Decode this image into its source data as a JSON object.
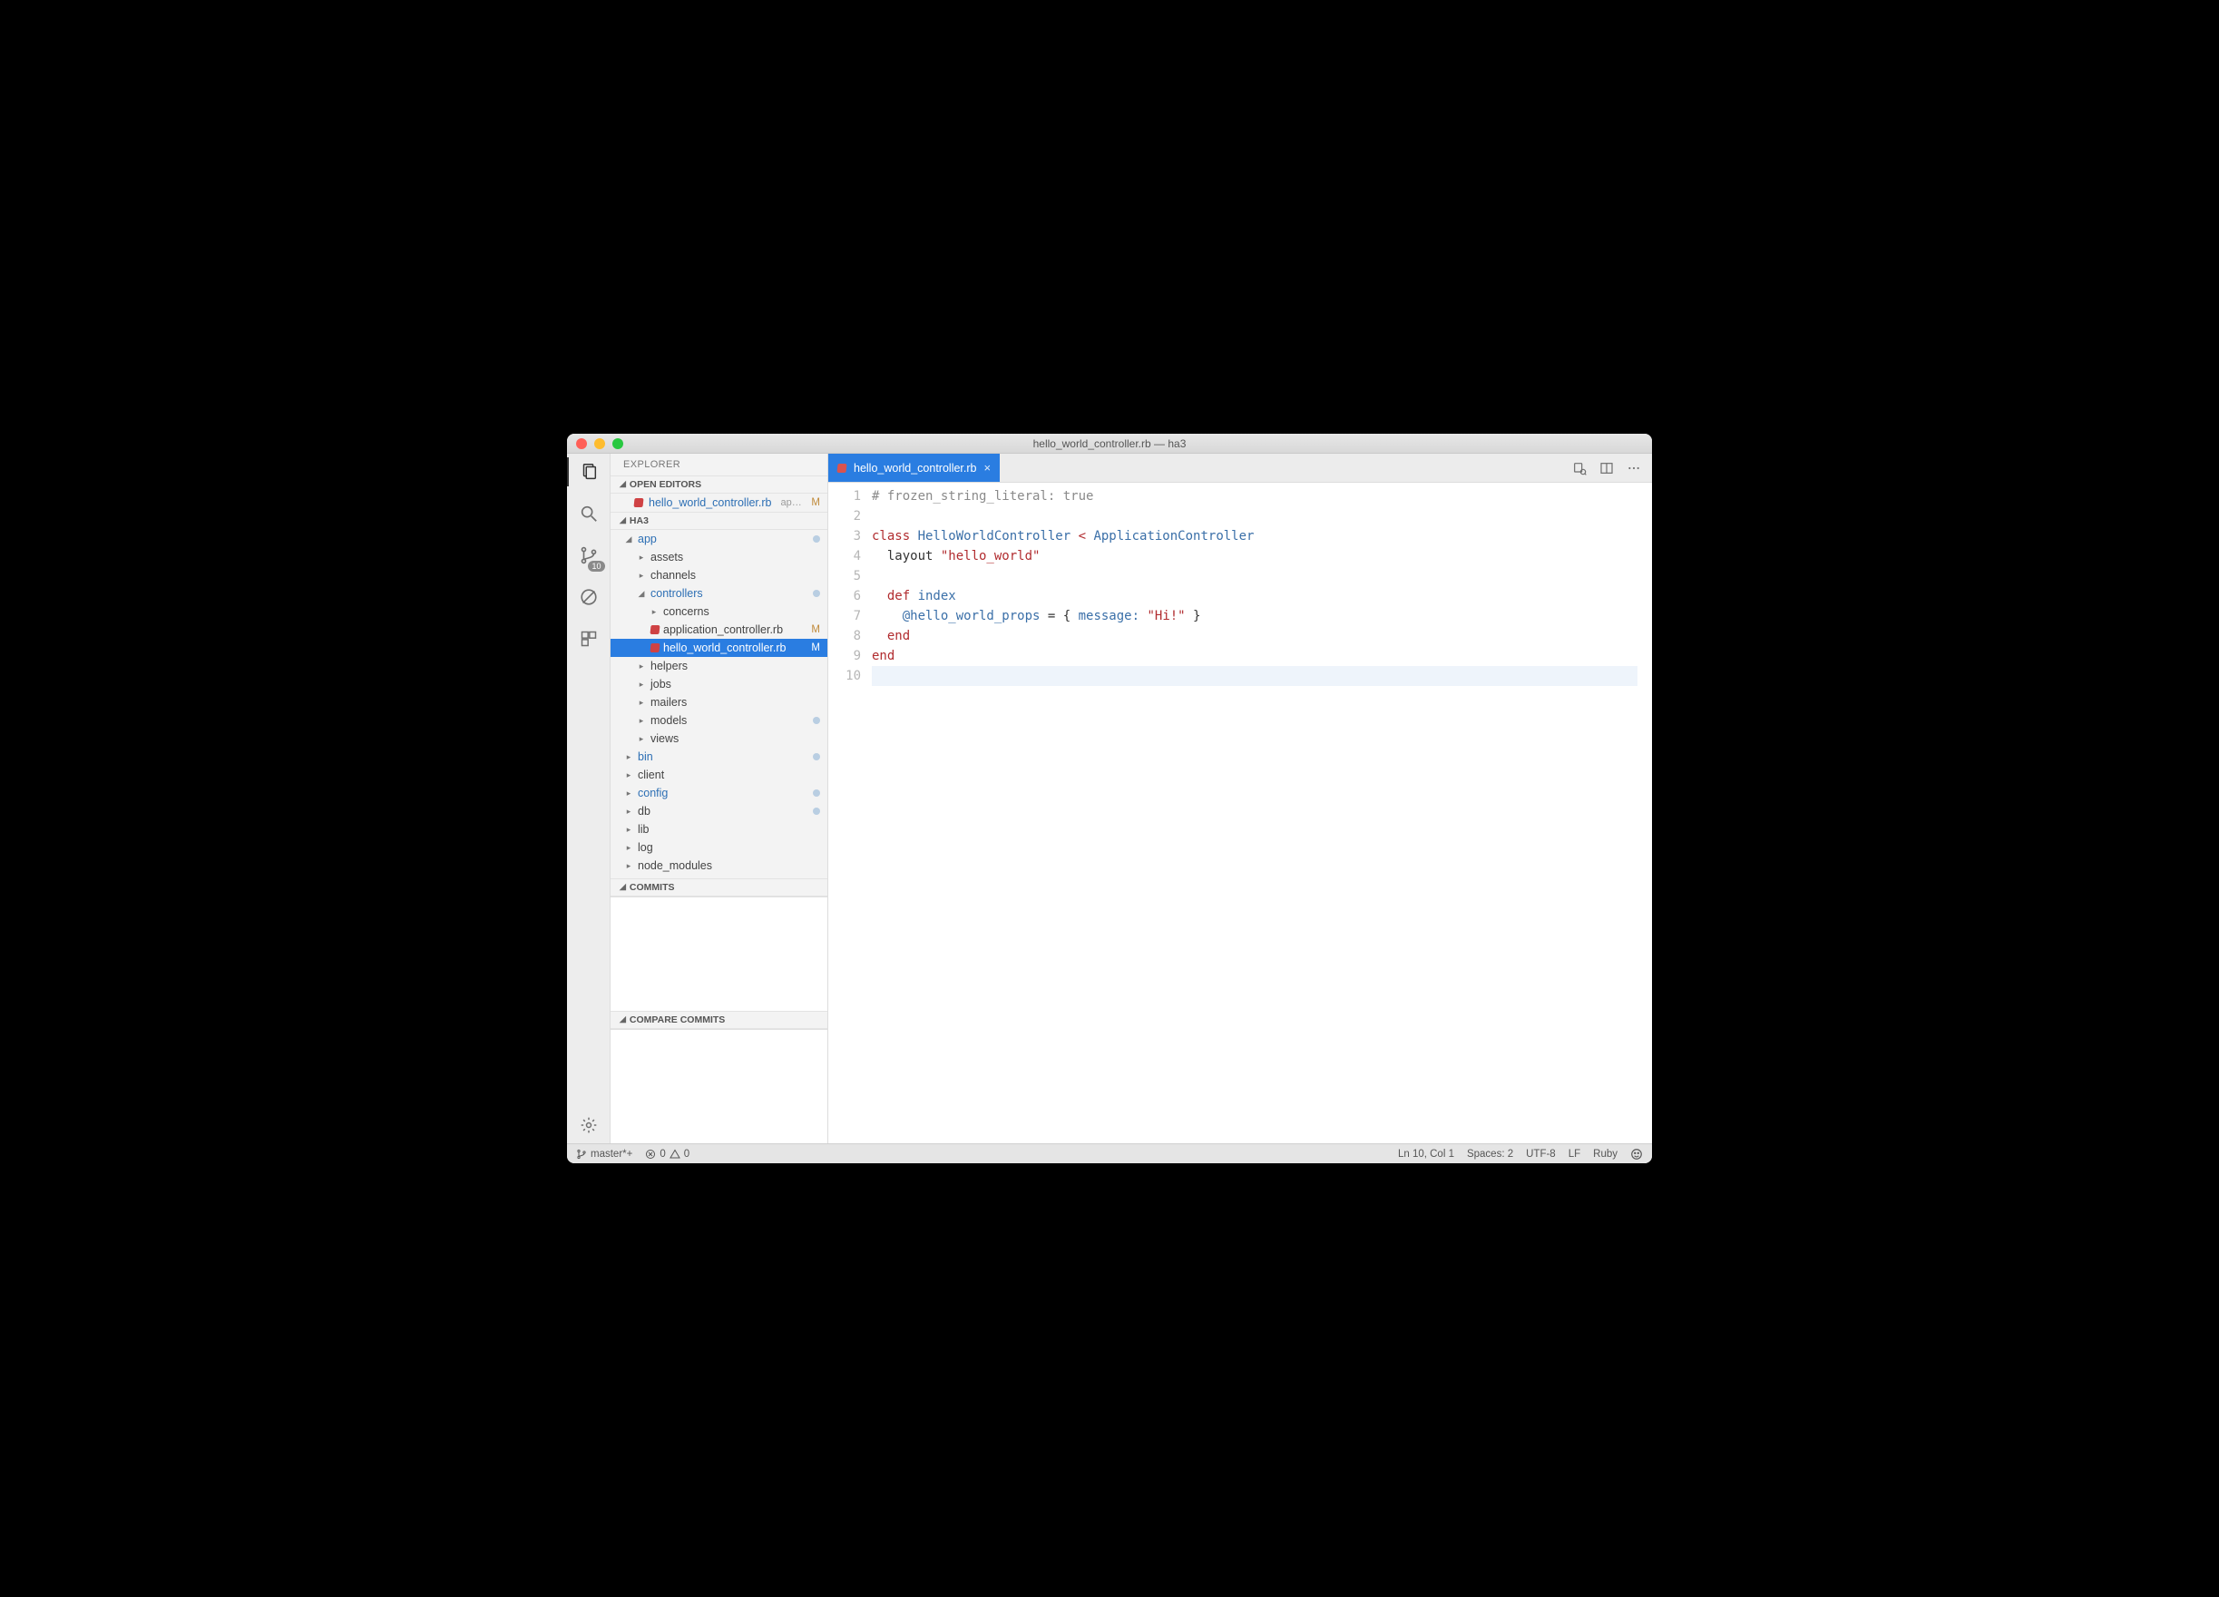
{
  "titlebar": {
    "title": "hello_world_controller.rb — ha3"
  },
  "sidebar": {
    "title": "EXPLORER",
    "sections": {
      "open_editors": "OPEN EDITORS",
      "project": "HA3",
      "commits": "COMMITS",
      "compare": "COMPARE COMMITS"
    },
    "open_editor": {
      "name": "hello_world_controller.rb",
      "path": "ap…",
      "badge": "M"
    },
    "tree": [
      {
        "depth": 0,
        "label": "app",
        "expandable": true,
        "expanded": true,
        "link": true,
        "dot": true
      },
      {
        "depth": 1,
        "label": "assets",
        "expandable": true
      },
      {
        "depth": 1,
        "label": "channels",
        "expandable": true
      },
      {
        "depth": 1,
        "label": "controllers",
        "expandable": true,
        "expanded": true,
        "link": true,
        "dot": true
      },
      {
        "depth": 2,
        "label": "concerns",
        "expandable": true
      },
      {
        "depth": 2,
        "label": "application_controller.rb",
        "ruby": true,
        "m": "M"
      },
      {
        "depth": 2,
        "label": "hello_world_controller.rb",
        "ruby": true,
        "m": "M",
        "selected": true
      },
      {
        "depth": 1,
        "label": "helpers",
        "expandable": true
      },
      {
        "depth": 1,
        "label": "jobs",
        "expandable": true
      },
      {
        "depth": 1,
        "label": "mailers",
        "expandable": true
      },
      {
        "depth": 1,
        "label": "models",
        "expandable": true,
        "dot": true
      },
      {
        "depth": 1,
        "label": "views",
        "expandable": true
      },
      {
        "depth": 0,
        "label": "bin",
        "expandable": true,
        "link": true,
        "dot": true
      },
      {
        "depth": 0,
        "label": "client",
        "expandable": true
      },
      {
        "depth": 0,
        "label": "config",
        "expandable": true,
        "link": true,
        "dot": true
      },
      {
        "depth": 0,
        "label": "db",
        "expandable": true,
        "dot": true
      },
      {
        "depth": 0,
        "label": "lib",
        "expandable": true
      },
      {
        "depth": 0,
        "label": "log",
        "expandable": true
      },
      {
        "depth": 0,
        "label": "node_modules",
        "expandable": true
      }
    ]
  },
  "activity": {
    "badge": "10"
  },
  "tab": {
    "name": "hello_world_controller.rb"
  },
  "code": {
    "lines": [
      [
        {
          "t": "# frozen_string_literal: true",
          "c": "tok-comment"
        }
      ],
      [],
      [
        {
          "t": "class ",
          "c": "tok-kw"
        },
        {
          "t": "HelloWorldController",
          "c": "tok-type"
        },
        {
          "t": " < ",
          "c": "tok-op"
        },
        {
          "t": "ApplicationController",
          "c": "tok-type"
        }
      ],
      [
        {
          "t": "  layout ",
          "c": "tok-layout"
        },
        {
          "t": "\"hello_world\"",
          "c": "tok-strq"
        }
      ],
      [],
      [
        {
          "t": "  ",
          "c": ""
        },
        {
          "t": "def ",
          "c": "tok-kw"
        },
        {
          "t": "index",
          "c": "tok-def"
        }
      ],
      [
        {
          "t": "    ",
          "c": ""
        },
        {
          "t": "@hello_world_props",
          "c": "tok-ivar"
        },
        {
          "t": " = { ",
          "c": ""
        },
        {
          "t": "message:",
          "c": "tok-key"
        },
        {
          "t": " ",
          "c": ""
        },
        {
          "t": "\"Hi!\"",
          "c": "tok-strq"
        },
        {
          "t": " }",
          "c": ""
        }
      ],
      [
        {
          "t": "  ",
          "c": ""
        },
        {
          "t": "end",
          "c": "tok-kw"
        }
      ],
      [
        {
          "t": "end",
          "c": "tok-kw"
        }
      ],
      []
    ]
  },
  "status": {
    "branch": "master*+",
    "errors": "0",
    "warnings": "0",
    "lncol": "Ln 10, Col 1",
    "spaces": "Spaces: 2",
    "encoding": "UTF-8",
    "eol": "LF",
    "lang": "Ruby"
  }
}
